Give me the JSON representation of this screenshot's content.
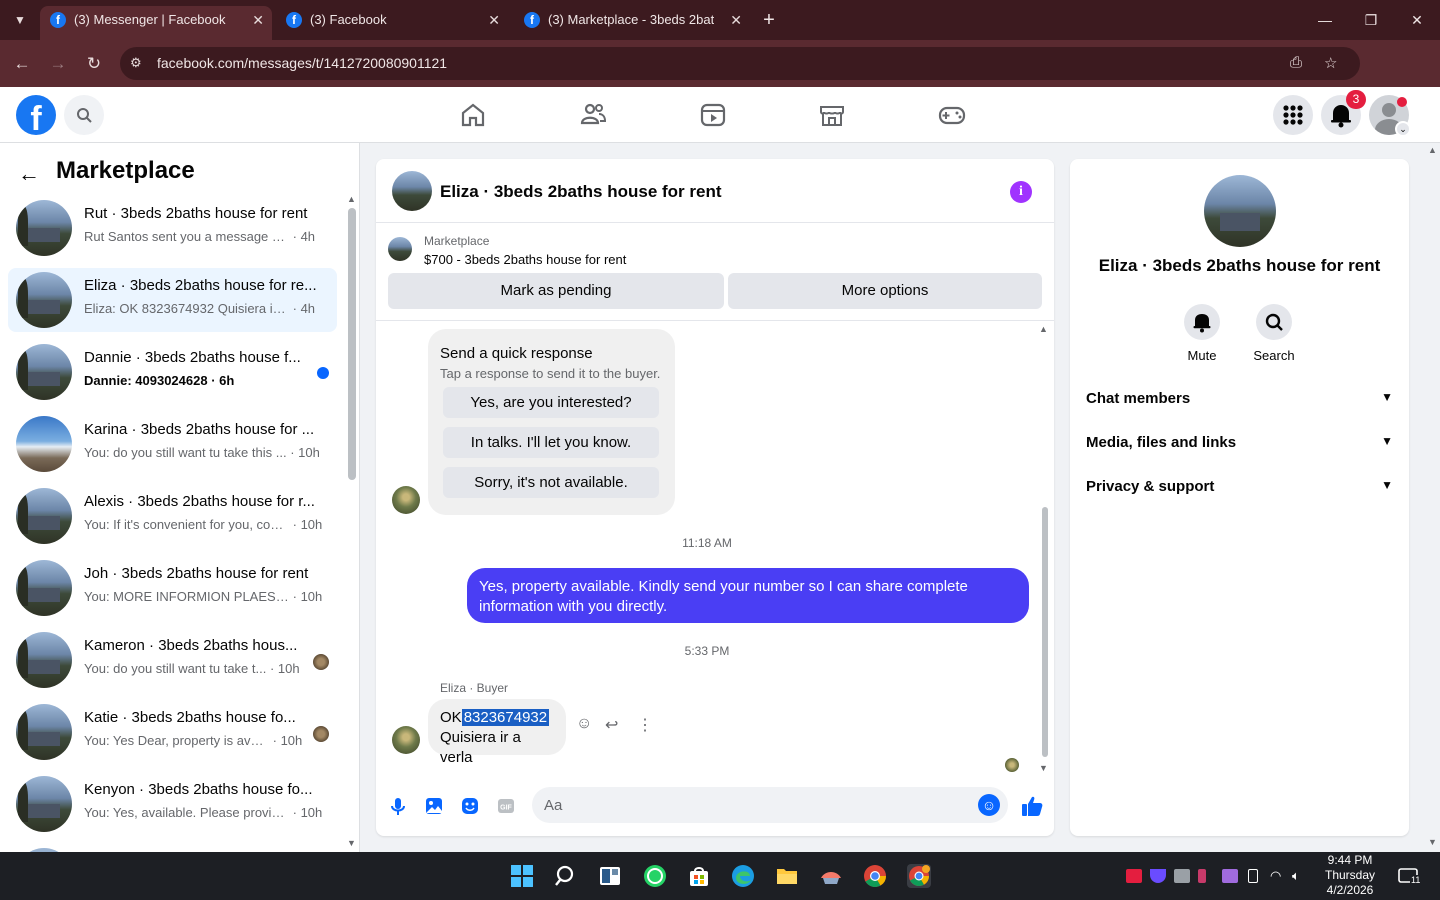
{
  "browser": {
    "tabs": [
      {
        "title": "(3) Messenger | Facebook",
        "active": true
      },
      {
        "title": "(3) Facebook",
        "active": false
      },
      {
        "title": "(3) Marketplace - 3beds 2baths",
        "active": false
      }
    ],
    "url": "facebook.com/messages/t/1412720080901121"
  },
  "header": {
    "notification_count": "3"
  },
  "sidebar": {
    "title": "Marketplace",
    "conversations": [
      {
        "name": "Rut · 3beds 2baths house for rent",
        "snippet": "Rut Santos sent you a message abo...",
        "time": "4h",
        "unread": false,
        "active": false
      },
      {
        "name": "Eliza · 3beds 2baths house for re...",
        "snippet": "Eliza: OK 8323674932 Quisiera ir a ...",
        "time": "4h",
        "unread": false,
        "active": true
      },
      {
        "name": "Dannie · 3beds 2baths house f...",
        "snippet": "Dannie: 4093024628",
        "time": "6h",
        "unread": true,
        "active": false
      },
      {
        "name": "Karina · 3beds 2baths house for ...",
        "snippet": "You: do you still want tu take this ...",
        "time": "10h",
        "unread": false,
        "active": false
      },
      {
        "name": "Alexis · 3beds 2baths house for r...",
        "snippet": "You: If it's convenient for you, coul...",
        "time": "10h",
        "unread": false,
        "active": false
      },
      {
        "name": "Joh · 3beds 2baths house for rent",
        "snippet": "You: MORE INFORMION PLAES SE...",
        "time": "10h",
        "unread": false,
        "active": false
      },
      {
        "name": "Kameron · 3beds 2baths hous...",
        "snippet": "You: do you still want tu take t...",
        "time": "10h",
        "unread": false,
        "active": false
      },
      {
        "name": "Katie · 3beds 2baths house fo...",
        "snippet": "You: Yes Dear, property is availa...",
        "time": "10h",
        "unread": false,
        "active": false
      },
      {
        "name": "Kenyon · 3beds 2baths house fo...",
        "snippet": "You: Yes, available. Please provide ...",
        "time": "10h",
        "unread": false,
        "active": false
      }
    ]
  },
  "chat": {
    "title": "Eliza · 3beds 2baths house for rent",
    "marketplace_label": "Marketplace",
    "listing": "$700 - 3beds 2baths house for rent",
    "mark_pending": "Mark as pending",
    "more_options": "More options",
    "quick_response": {
      "title": "Send a quick response",
      "subtitle": "Tap a response to send it to the buyer.",
      "options": [
        "Yes, are you interested?",
        "In talks. I'll let you know.",
        "Sorry, it's not available."
      ]
    },
    "time1": "11:18 AM",
    "outgoing": "Yes, property available. Kindly send your number so I can share complete information with you directly.",
    "time2": "5:33 PM",
    "sender_label": "Eliza · Buyer",
    "incoming_prefix": "OK",
    "incoming_selected": "8323674932",
    "incoming_line2": "Quisiera ir a verla",
    "composer_placeholder": "Aa"
  },
  "details": {
    "name": "Eliza · 3beds 2baths house for rent",
    "mute": "Mute",
    "search": "Search",
    "sections": [
      "Chat members",
      "Media, files and links",
      "Privacy & support"
    ]
  },
  "taskbar": {
    "time": "9:44 PM",
    "day": "Thursday",
    "date": "4/2/2026",
    "notif_count": "11"
  },
  "colors": {
    "fb_blue": "#1877f2",
    "outgoing_bubble": "#4a3ef4",
    "active_conv": "#ebf5ff",
    "info_purple": "#a033ff"
  }
}
